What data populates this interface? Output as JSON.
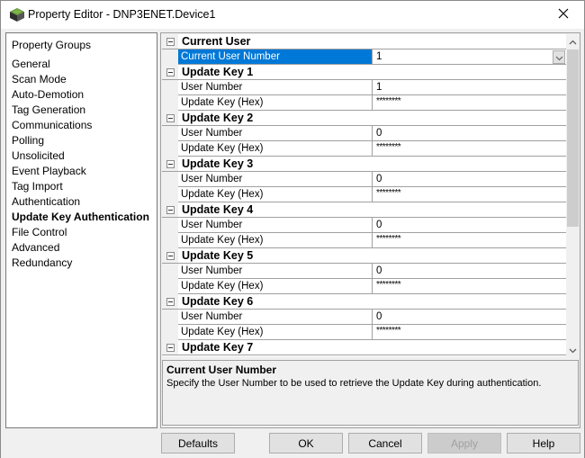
{
  "window": {
    "title": "Property Editor - DNP3ENET.Device1",
    "icons": {
      "app": "app-cube-icon",
      "close": "close-icon"
    }
  },
  "sidebar": {
    "header": "Property Groups",
    "items": [
      {
        "label": "General",
        "active": false
      },
      {
        "label": "Scan Mode",
        "active": false
      },
      {
        "label": "Auto-Demotion",
        "active": false
      },
      {
        "label": "Tag Generation",
        "active": false
      },
      {
        "label": "Communications",
        "active": false
      },
      {
        "label": "Polling",
        "active": false
      },
      {
        "label": "Unsolicited",
        "active": false
      },
      {
        "label": "Event Playback",
        "active": false
      },
      {
        "label": "Tag Import",
        "active": false
      },
      {
        "label": "Authentication",
        "active": false
      },
      {
        "label": "Update Key Authentication",
        "active": true
      },
      {
        "label": "File Control",
        "active": false
      },
      {
        "label": "Advanced",
        "active": false
      },
      {
        "label": "Redundancy",
        "active": false
      }
    ]
  },
  "grid": {
    "categories": [
      {
        "label": "Current User",
        "expanded": true,
        "properties": [
          {
            "name": "Current User Number",
            "value": "1",
            "selected": true,
            "dropdown": true
          }
        ]
      },
      {
        "label": "Update Key 1",
        "expanded": true,
        "properties": [
          {
            "name": "User Number",
            "value": "1"
          },
          {
            "name": "Update Key (Hex)",
            "value": "********",
            "masked": true
          }
        ]
      },
      {
        "label": "Update Key 2",
        "expanded": true,
        "properties": [
          {
            "name": "User Number",
            "value": "0"
          },
          {
            "name": "Update Key (Hex)",
            "value": "********",
            "masked": true
          }
        ]
      },
      {
        "label": "Update Key 3",
        "expanded": true,
        "properties": [
          {
            "name": "User Number",
            "value": "0"
          },
          {
            "name": "Update Key (Hex)",
            "value": "********",
            "masked": true
          }
        ]
      },
      {
        "label": "Update Key 4",
        "expanded": true,
        "properties": [
          {
            "name": "User Number",
            "value": "0"
          },
          {
            "name": "Update Key (Hex)",
            "value": "********",
            "masked": true
          }
        ]
      },
      {
        "label": "Update Key 5",
        "expanded": true,
        "properties": [
          {
            "name": "User Number",
            "value": "0"
          },
          {
            "name": "Update Key (Hex)",
            "value": "********",
            "masked": true
          }
        ]
      },
      {
        "label": "Update Key 6",
        "expanded": true,
        "properties": [
          {
            "name": "User Number",
            "value": "0"
          },
          {
            "name": "Update Key (Hex)",
            "value": "********",
            "masked": true
          }
        ]
      },
      {
        "label": "Update Key 7",
        "expanded": true,
        "properties": []
      }
    ],
    "icons": {
      "expander": "collapse-minus-icon",
      "dropdown": "chevron-down-icon",
      "scroll_up": "chevron-up-icon",
      "scroll_down": "chevron-down-icon"
    },
    "accent_color": "#0078d7"
  },
  "description": {
    "title": "Current User Number",
    "text": "Specify the User Number to be used to retrieve the Update Key during authentication."
  },
  "buttons": {
    "defaults": "Defaults",
    "ok": "OK",
    "cancel": "Cancel",
    "apply": "Apply",
    "help": "Help"
  }
}
